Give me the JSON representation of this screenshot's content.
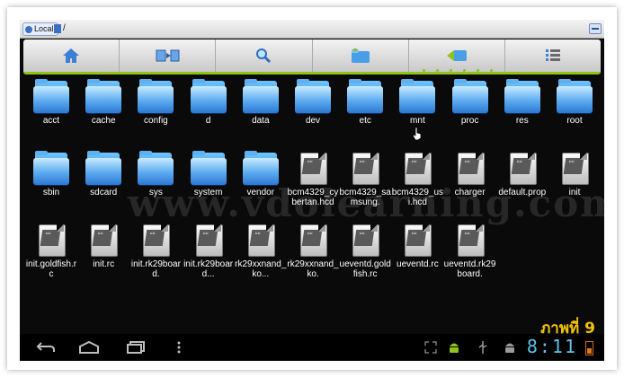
{
  "titlebar": {
    "location_chip": "Local",
    "path": "/"
  },
  "toolbar": {
    "buttons": [
      "home-icon",
      "copy-files-icon",
      "search-icon",
      "new-folder-icon",
      "back-icon",
      "list-view-icon"
    ]
  },
  "files": [
    {
      "name": "acct",
      "type": "folder"
    },
    {
      "name": "cache",
      "type": "folder"
    },
    {
      "name": "config",
      "type": "folder"
    },
    {
      "name": "d",
      "type": "folder"
    },
    {
      "name": "data",
      "type": "folder"
    },
    {
      "name": "dev",
      "type": "folder"
    },
    {
      "name": "etc",
      "type": "folder"
    },
    {
      "name": "mnt",
      "type": "folder"
    },
    {
      "name": "proc",
      "type": "folder"
    },
    {
      "name": "res",
      "type": "folder"
    },
    {
      "name": "root",
      "type": "folder"
    },
    {
      "name": "sbin",
      "type": "folder"
    },
    {
      "name": "sdcard",
      "type": "folder"
    },
    {
      "name": "sys",
      "type": "folder"
    },
    {
      "name": "system",
      "type": "folder"
    },
    {
      "name": "vendor",
      "type": "folder"
    },
    {
      "name": "bcm4329_cybertan.hcd",
      "type": "file"
    },
    {
      "name": "bcm4329_samsung.",
      "type": "file"
    },
    {
      "name": "bcm4329_usi.hcd",
      "type": "file"
    },
    {
      "name": "charger",
      "type": "file"
    },
    {
      "name": "default.prop",
      "type": "file"
    },
    {
      "name": "init",
      "type": "file"
    },
    {
      "name": "init.goldfish.rc",
      "type": "file"
    },
    {
      "name": "init.rc",
      "type": "file"
    },
    {
      "name": "init.rk29board.",
      "type": "file"
    },
    {
      "name": "init.rk29board...",
      "type": "file"
    },
    {
      "name": "rk29xxnand_ko...",
      "type": "file"
    },
    {
      "name": "rk29xxnand_ko.",
      "type": "file"
    },
    {
      "name": "ueventd.goldfish.rc",
      "type": "file"
    },
    {
      "name": "ueventd.rc",
      "type": "file"
    },
    {
      "name": "ueventd.rk29board.",
      "type": "file"
    }
  ],
  "watermark": "www.vdolearning.com",
  "caption": "ภาพที่ 9",
  "statusbar": {
    "time": "8:11"
  },
  "colors": {
    "accent_green": "#8fc21a",
    "clock": "#5fc2e8",
    "caption": "#f2c200",
    "folder_blue": "#3a8ee6"
  }
}
